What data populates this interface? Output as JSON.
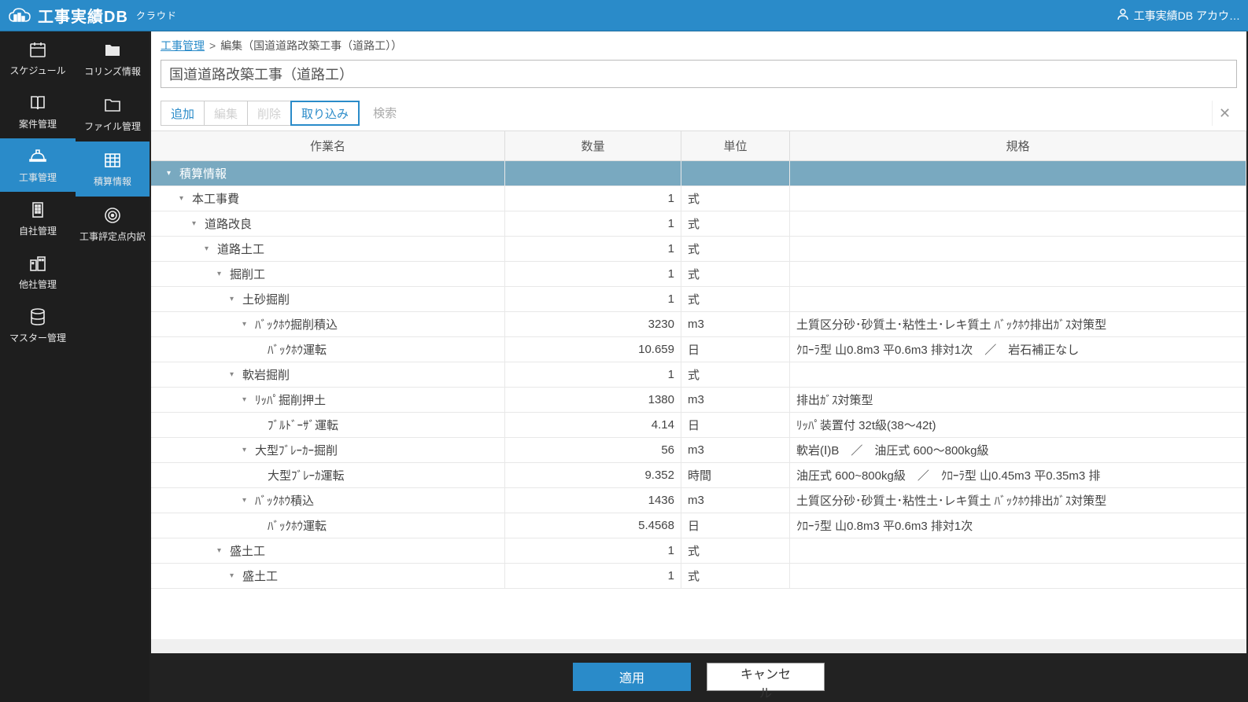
{
  "app": {
    "title": "工事実績DB",
    "subtitle": "クラウド",
    "account_label": "工事実績DB アカウ…"
  },
  "sidebar_left": [
    {
      "label": "スケジュール",
      "icon": "calendar-icon"
    },
    {
      "label": "案件管理",
      "icon": "books-icon"
    },
    {
      "label": "工事管理",
      "icon": "hardhat-icon",
      "selected": true
    },
    {
      "label": "自社管理",
      "icon": "building-icon"
    },
    {
      "label": "他社管理",
      "icon": "city-icon"
    },
    {
      "label": "マスター管理",
      "icon": "database-icon"
    }
  ],
  "sidebar_sub": [
    {
      "label": "コリンズ情報",
      "icon": "folder-filled-icon"
    },
    {
      "label": "ファイル管理",
      "icon": "folder-icon"
    },
    {
      "label": "積算情報",
      "icon": "table-icon",
      "selected": true
    },
    {
      "label": "工事評定点内訳",
      "icon": "target-icon"
    }
  ],
  "breadcrumb": {
    "link_label": "工事管理",
    "current_label": "編集（国道道路改築工事（道路工））"
  },
  "title_input": "国道道路改築工事（道路工）",
  "toolbar": {
    "add_label": "追加",
    "edit_label": "編集",
    "delete_label": "削除",
    "import_label": "取り込み",
    "search_placeholder": "検索"
  },
  "grid": {
    "headers": {
      "name": "作業名",
      "qty": "数量",
      "unit": "単位",
      "spec": "規格"
    },
    "rows": [
      {
        "depth": 0,
        "expand": true,
        "selected": true,
        "name": "積算情報",
        "qty": "",
        "unit": "",
        "spec": ""
      },
      {
        "depth": 1,
        "expand": true,
        "name": "本工事費",
        "qty": "1",
        "unit": "式",
        "spec": ""
      },
      {
        "depth": 2,
        "expand": true,
        "name": "道路改良",
        "qty": "1",
        "unit": "式",
        "spec": ""
      },
      {
        "depth": 3,
        "expand": true,
        "name": "道路土工",
        "qty": "1",
        "unit": "式",
        "spec": ""
      },
      {
        "depth": 4,
        "expand": true,
        "name": "掘削工",
        "qty": "1",
        "unit": "式",
        "spec": ""
      },
      {
        "depth": 5,
        "expand": true,
        "name": "土砂掘削",
        "qty": "1",
        "unit": "式",
        "spec": ""
      },
      {
        "depth": 6,
        "expand": true,
        "name": "ﾊﾞｯｸﾎｳ掘削積込",
        "qty": "3230",
        "unit": "m3",
        "spec": "土質区分砂･砂質土･粘性土･レキ質土 ﾊﾞｯｸﾎｳ排出ｶﾞｽ対策型"
      },
      {
        "depth": 7,
        "leaf": true,
        "name": "ﾊﾞｯｸﾎｳ運転",
        "qty": "10.659",
        "unit": "日",
        "spec": "ｸﾛｰﾗ型 山0.8m3 平0.6m3 排対1次　／　岩石補正なし"
      },
      {
        "depth": 5,
        "expand": true,
        "name": "軟岩掘削",
        "qty": "1",
        "unit": "式",
        "spec": ""
      },
      {
        "depth": 6,
        "expand": true,
        "name": "ﾘｯﾊﾟ掘削押土",
        "qty": "1380",
        "unit": "m3",
        "spec": "排出ｶﾞｽ対策型"
      },
      {
        "depth": 7,
        "leaf": true,
        "name": "ﾌﾞﾙﾄﾞｰｻﾞ運転",
        "qty": "4.14",
        "unit": "日",
        "spec": "ﾘｯﾊﾟ装置付 32t級(38～42t)"
      },
      {
        "depth": 6,
        "expand": true,
        "name": "大型ﾌﾞﾚｰｶｰ掘削",
        "qty": "56",
        "unit": "m3",
        "spec": "軟岩(Ⅰ)B　／　油圧式 600～800kg級"
      },
      {
        "depth": 7,
        "leaf": true,
        "name": "大型ﾌﾞﾚｰｶ運転",
        "qty": "9.352",
        "unit": "時間",
        "spec": "油圧式 600~800kg級　／　ｸﾛｰﾗ型 山0.45m3 平0.35m3 排"
      },
      {
        "depth": 6,
        "expand": true,
        "name": "ﾊﾞｯｸﾎｳ積込",
        "qty": "1436",
        "unit": "m3",
        "spec": "土質区分砂･砂質土･粘性土･レキ質土 ﾊﾞｯｸﾎｳ排出ｶﾞｽ対策型"
      },
      {
        "depth": 7,
        "leaf": true,
        "name": "ﾊﾞｯｸﾎｳ運転",
        "qty": "5.4568",
        "unit": "日",
        "spec": "ｸﾛｰﾗ型 山0.8m3 平0.6m3 排対1次"
      },
      {
        "depth": 4,
        "expand": true,
        "name": "盛土工",
        "qty": "1",
        "unit": "式",
        "spec": ""
      },
      {
        "depth": 5,
        "expand": true,
        "name": "盛土工",
        "qty": "1",
        "unit": "式",
        "spec": ""
      }
    ]
  },
  "footer": {
    "apply_label": "適用",
    "cancel_label": "キャンセル"
  }
}
